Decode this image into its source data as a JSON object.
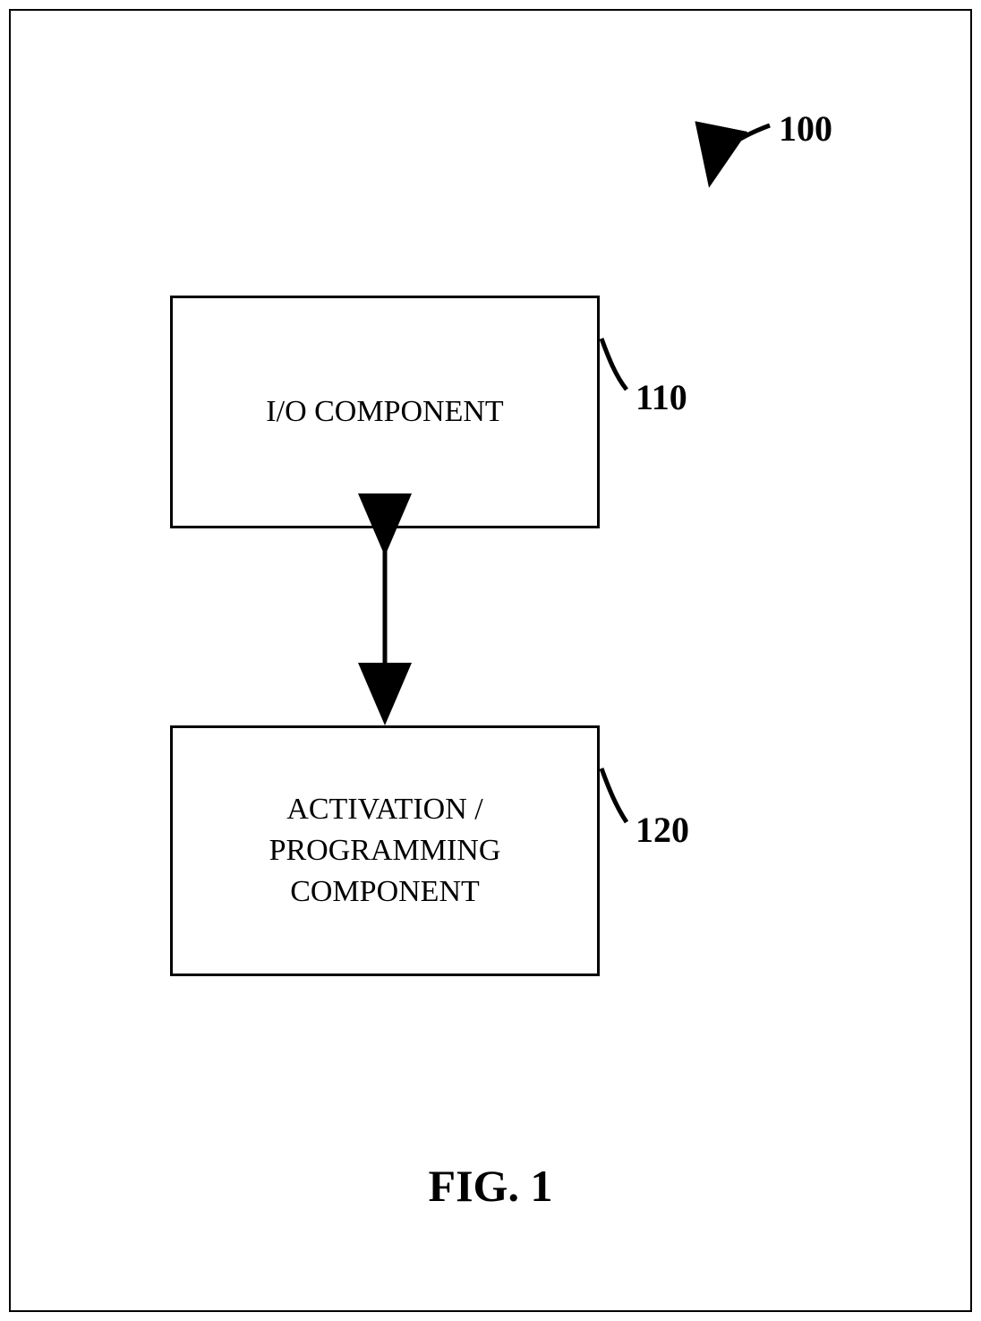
{
  "labels": {
    "system": "100",
    "box110": "110",
    "box120": "120"
  },
  "boxes": {
    "b110": "I/O COMPONENT",
    "b120": "ACTIVATION /\nPROGRAMMING\nCOMPONENT"
  },
  "figure": "FIG. 1"
}
